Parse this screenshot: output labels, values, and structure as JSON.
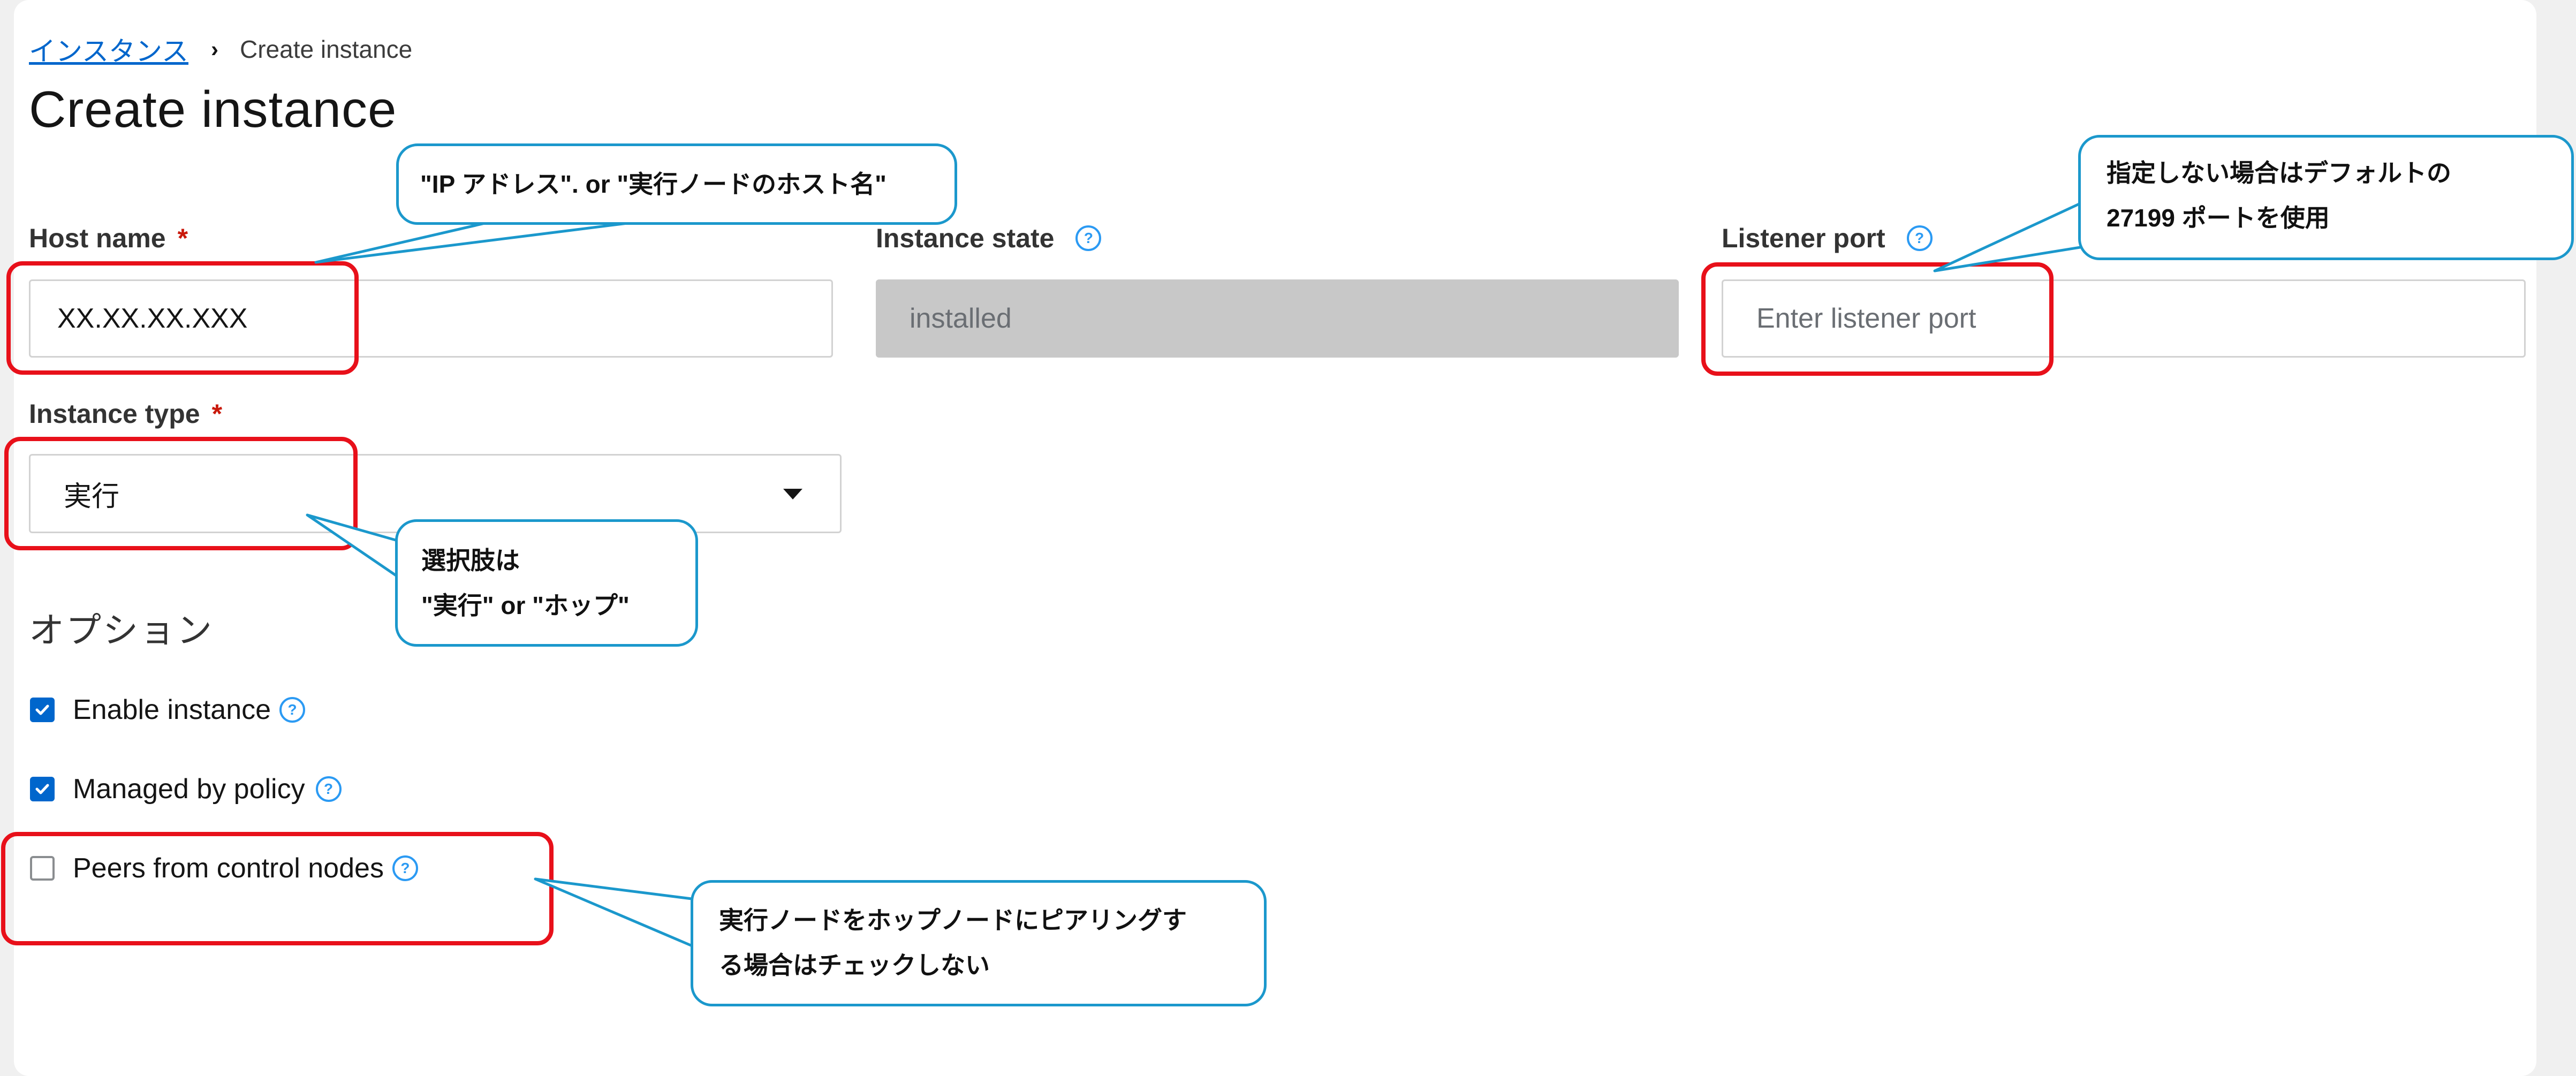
{
  "breadcrumb": {
    "parent": "インスタンス",
    "separator": "›",
    "current": "Create instance"
  },
  "page_title": "Create instance",
  "form": {
    "host_name": {
      "label": "Host name",
      "required_mark": "*",
      "value": "XX.XX.XX.XXX"
    },
    "instance_state": {
      "label": "Instance state",
      "value": "installed"
    },
    "listener_port": {
      "label": "Listener port",
      "placeholder": "Enter listener port"
    },
    "instance_type": {
      "label": "Instance type",
      "required_mark": "*",
      "value": "実行"
    },
    "help_icon_glyph": "?"
  },
  "options": {
    "title": "オプション",
    "checkboxes": [
      {
        "label": "Enable instance",
        "checked": true
      },
      {
        "label": "Managed by policy",
        "checked": true
      },
      {
        "label": "Peers from control nodes",
        "checked": false
      }
    ]
  },
  "callouts": {
    "host_name": "\"IP アドレス\".  or  \"実行ノードのホスト名\"",
    "listener_port": [
      "指定しない場合はデフォルトの",
      "27199 ポートを使用"
    ],
    "instance_type": [
      "選択肢は",
      "\"実行\" or  \"ホップ\""
    ],
    "peers": [
      "実行ノードをホップノードにピアリングす",
      "る場合はチェックしない"
    ]
  },
  "colors": {
    "accent": "#0066cc",
    "required": "#c9190b",
    "annotation_box": "#e8101a",
    "callout_border": "#1b98cc",
    "disabled_field": "#c8c8c8"
  },
  "icons": {
    "breadcrumb_separator": "chevron-right-icon",
    "help": "help-circle-icon",
    "select_caret": "caret-down-icon",
    "check": "check-icon"
  }
}
